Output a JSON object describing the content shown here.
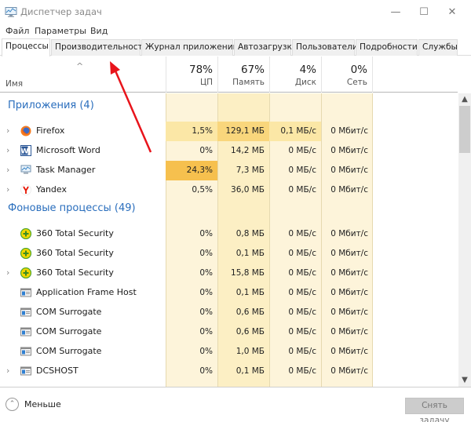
{
  "window": {
    "title": "Диспетчер задач",
    "icon": "task-manager-icon",
    "controls": {
      "minimize": "—",
      "maximize": "☐",
      "close": "✕"
    }
  },
  "menu": [
    "Файл",
    "Параметры",
    "Вид"
  ],
  "tabs": [
    {
      "label": "Процессы",
      "active": true
    },
    {
      "label": "Производительность",
      "active": false
    },
    {
      "label": "Журнал приложений",
      "active": false
    },
    {
      "label": "Автозагрузка",
      "active": false
    },
    {
      "label": "Пользователи",
      "active": false
    },
    {
      "label": "Подробности",
      "active": false
    },
    {
      "label": "Службы",
      "active": false
    }
  ],
  "header": {
    "sort_indicator": "^",
    "name_label": "Имя",
    "columns": [
      {
        "pct": "78%",
        "label": "ЦП"
      },
      {
        "pct": "67%",
        "label": "Память"
      },
      {
        "pct": "4%",
        "label": "Диск"
      },
      {
        "pct": "0%",
        "label": "Сеть"
      }
    ]
  },
  "groups": [
    {
      "title": "Приложения (4)",
      "rows": [
        {
          "name": "Firefox",
          "icon": "firefox-icon",
          "expandable": true,
          "cpu": "1,5%",
          "mem": "129,1 МБ",
          "disk": "0,1 МБ/с",
          "net": "0 Мбит/с",
          "cpu_heat": 1,
          "mem_heat": 2
        },
        {
          "name": "Microsoft Word",
          "icon": "word-icon",
          "expandable": true,
          "cpu": "0%",
          "mem": "14,2 МБ",
          "disk": "0 МБ/с",
          "net": "0 Мбит/с",
          "cpu_heat": 0,
          "mem_heat": 0
        },
        {
          "name": "Task Manager",
          "icon": "task-manager-icon",
          "expandable": true,
          "cpu": "24,3%",
          "mem": "7,3 МБ",
          "disk": "0 МБ/с",
          "net": "0 Мбит/с",
          "cpu_heat": 3,
          "mem_heat": 0
        },
        {
          "name": "Yandex",
          "icon": "yandex-icon",
          "expandable": true,
          "cpu": "0,5%",
          "mem": "36,0 МБ",
          "disk": "0 МБ/с",
          "net": "0 Мбит/с",
          "cpu_heat": 0,
          "mem_heat": 0
        }
      ]
    },
    {
      "title": "Фоновые процессы (49)",
      "rows": [
        {
          "name": "360 Total Security",
          "icon": "360-security-icon",
          "expandable": false,
          "cpu": "0%",
          "mem": "0,8 МБ",
          "disk": "0 МБ/с",
          "net": "0 Мбит/с",
          "cpu_heat": 0,
          "mem_heat": 0
        },
        {
          "name": "360 Total Security",
          "icon": "360-security-icon",
          "expandable": false,
          "cpu": "0%",
          "mem": "0,1 МБ",
          "disk": "0 МБ/с",
          "net": "0 Мбит/с",
          "cpu_heat": 0,
          "mem_heat": 0
        },
        {
          "name": "360 Total Security",
          "icon": "360-security-icon",
          "expandable": true,
          "cpu": "0%",
          "mem": "15,8 МБ",
          "disk": "0 МБ/с",
          "net": "0 Мбит/с",
          "cpu_heat": 0,
          "mem_heat": 0
        },
        {
          "name": "Application Frame Host",
          "icon": "app-window-icon",
          "expandable": false,
          "cpu": "0%",
          "mem": "0,1 МБ",
          "disk": "0 МБ/с",
          "net": "0 Мбит/с",
          "cpu_heat": 0,
          "mem_heat": 0
        },
        {
          "name": "COM Surrogate",
          "icon": "app-window-icon",
          "expandable": false,
          "cpu": "0%",
          "mem": "0,6 МБ",
          "disk": "0 МБ/с",
          "net": "0 Мбит/с",
          "cpu_heat": 0,
          "mem_heat": 0
        },
        {
          "name": "COM Surrogate",
          "icon": "app-window-icon",
          "expandable": false,
          "cpu": "0%",
          "mem": "0,6 МБ",
          "disk": "0 МБ/с",
          "net": "0 Мбит/с",
          "cpu_heat": 0,
          "mem_heat": 0
        },
        {
          "name": "COM Surrogate",
          "icon": "app-window-icon",
          "expandable": false,
          "cpu": "0%",
          "mem": "1,0 МБ",
          "disk": "0 МБ/с",
          "net": "0 Мбит/с",
          "cpu_heat": 0,
          "mem_heat": 0
        },
        {
          "name": "DCSHOST",
          "icon": "app-window-icon",
          "expandable": true,
          "cpu": "0%",
          "mem": "0,1 МБ",
          "disk": "0 МБ/с",
          "net": "0 Мбит/с",
          "cpu_heat": 0,
          "mem_heat": 0
        }
      ]
    }
  ],
  "footer": {
    "less_label": "Меньше",
    "end_task_label": "Снять задачу"
  },
  "annotation": {
    "type": "red-arrow",
    "points_to": "Производительность",
    "color": "#e8141b"
  },
  "colors": {
    "group_title": "#2a6ebd",
    "heat_low": "#fdf4da",
    "heat_high": "#f6c04e",
    "annotation": "#e8141b"
  }
}
